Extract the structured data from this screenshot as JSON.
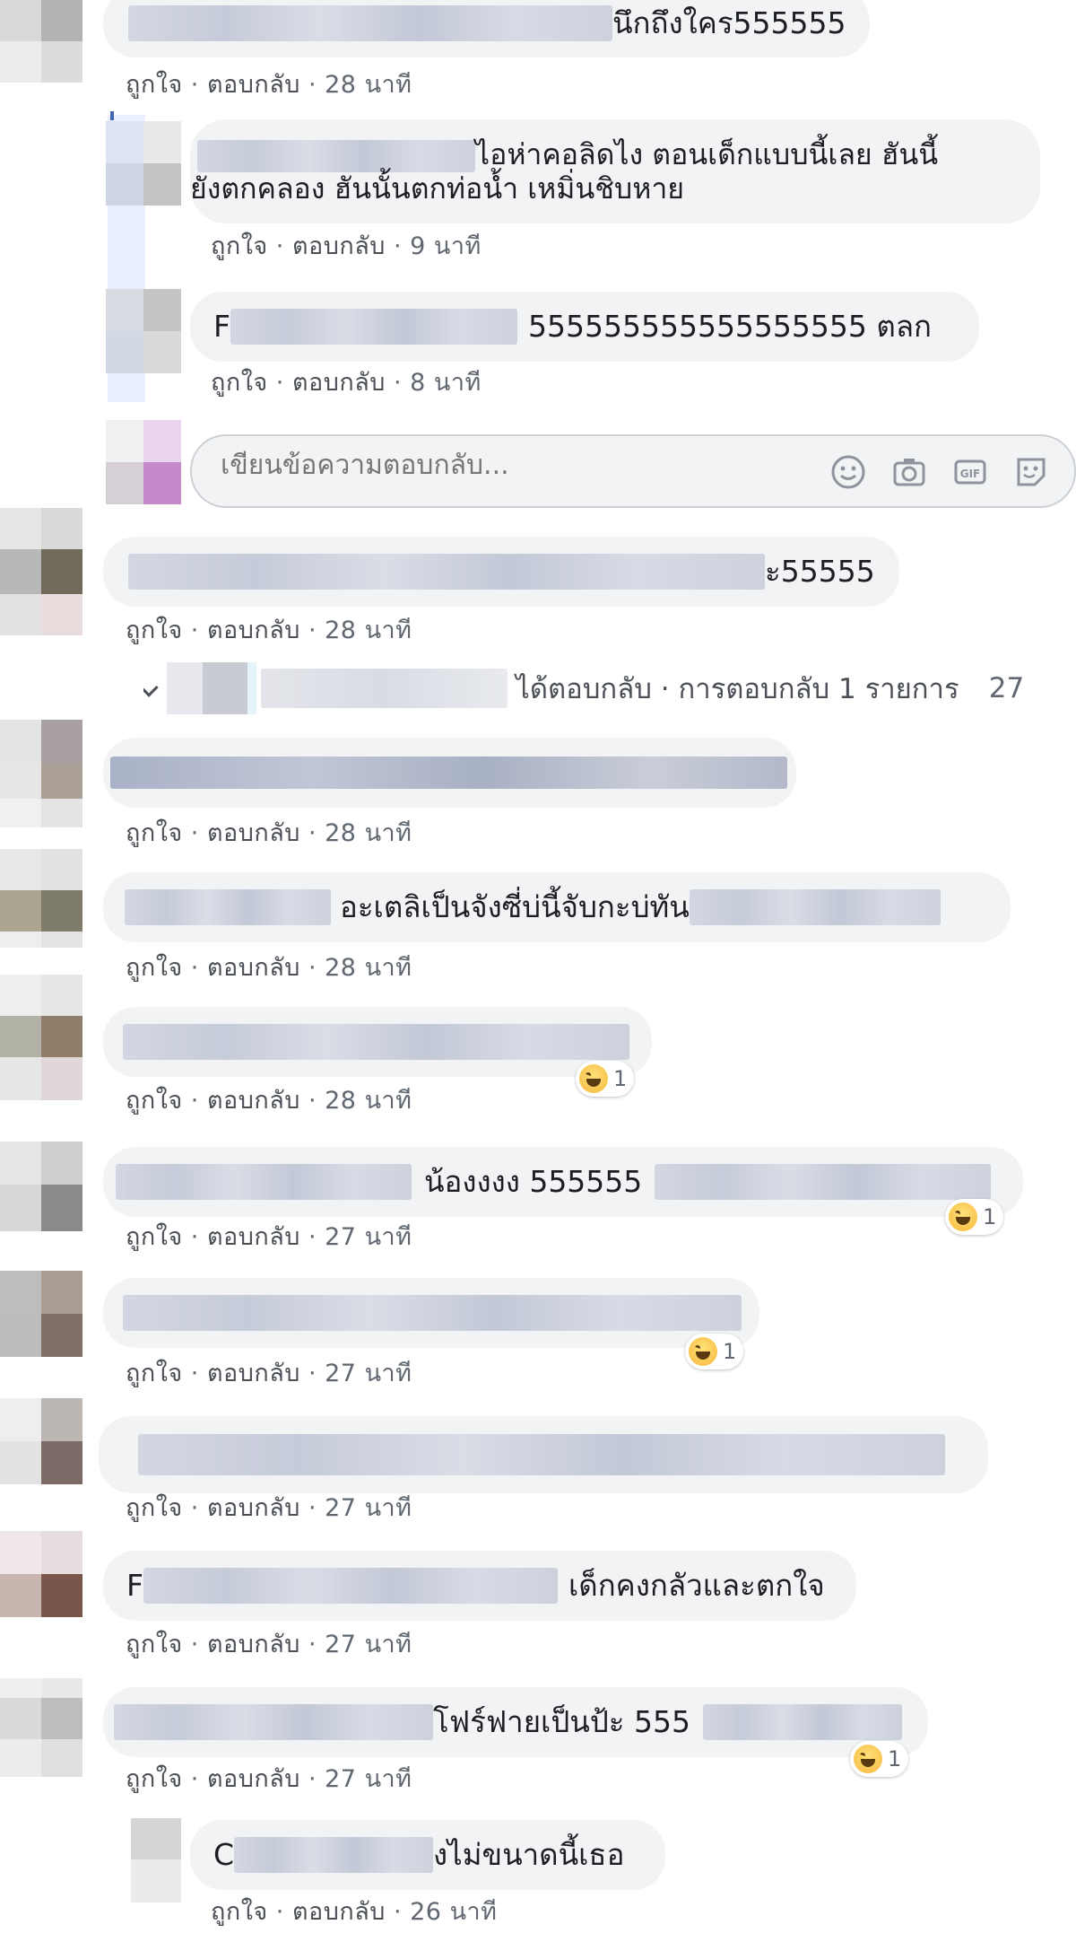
{
  "comments": [
    {
      "id": "c1",
      "text": "นึกถึงใคร555555",
      "actions": {
        "like": "ถูกใจ",
        "reply": "ตอบกลับ",
        "time": "28 นาที"
      }
    },
    {
      "id": "r1",
      "text_line1": "ไอห่าคอลิดไง ตอนเด็กแบบนี้เลย ฮันนี้",
      "text_line2": "ยังตกคลอง ฮันนั้นตกท่อน้ำ เหมิ่นชิบหาย",
      "actions": {
        "like": "ถูกใจ",
        "reply": "ตอบกลับ",
        "time": "9 นาที"
      }
    },
    {
      "id": "r2",
      "prefix": "F",
      "text": "555555555555555555 ตลก",
      "actions": {
        "like": "ถูกใจ",
        "reply": "ตอบกลับ",
        "time": "8 นาที"
      }
    },
    {
      "id": "c2",
      "text": "ะ55555",
      "actions": {
        "like": "ถูกใจ",
        "reply": "ตอบกลับ",
        "time": "28 นาที"
      }
    },
    {
      "id": "c3",
      "actions": {
        "like": "ถูกใจ",
        "reply": "ตอบกลับ",
        "time": "28 นาที"
      }
    },
    {
      "id": "c4",
      "text": "อะเตลิเป็นจังซี่บ่นี้จับกะบ่ทัน",
      "actions": {
        "like": "ถูกใจ",
        "reply": "ตอบกลับ",
        "time": "28 นาที"
      }
    },
    {
      "id": "c5",
      "reaction_count": "1",
      "actions": {
        "like": "ถูกใจ",
        "reply": "ตอบกลับ",
        "time": "28 นาที"
      }
    },
    {
      "id": "c6",
      "text": "น้องงงง 555555",
      "reaction_count": "1",
      "actions": {
        "like": "ถูกใจ",
        "reply": "ตอบกลับ",
        "time": "27 นาที"
      }
    },
    {
      "id": "c7",
      "reaction_count": "1",
      "actions": {
        "like": "ถูกใจ",
        "reply": "ตอบกลับ",
        "time": "27 นาที"
      }
    },
    {
      "id": "c8",
      "actions": {
        "like": "ถูกใจ",
        "reply": "ตอบกลับ",
        "time": "27 นาที"
      }
    },
    {
      "id": "c9",
      "prefix": "F",
      "text": "เด็กคงกลัวและตกใจ",
      "actions": {
        "like": "ถูกใจ",
        "reply": "ตอบกลับ",
        "time": "27 นาที"
      }
    },
    {
      "id": "c10",
      "text": "โฟร์ฟายเป็นป้ะ 555",
      "reaction_count": "1",
      "actions": {
        "like": "ถูกใจ",
        "reply": "ตอบกลับ",
        "time": "27 นาที"
      }
    },
    {
      "id": "r3",
      "prefix": "C",
      "text": "งไม่ขนาดนี้เธอ",
      "actions": {
        "like": "ถูกใจ",
        "reply": "ตอบกลับ",
        "time": "26 นาที"
      }
    }
  ],
  "reply_box": {
    "placeholder": "เขียนข้อความตอบกลับ..."
  },
  "replies_summary": {
    "text": "ได้ตอบกลับ · การตอบกลับ 1 รายการ",
    "time": "27"
  },
  "separator": " · "
}
